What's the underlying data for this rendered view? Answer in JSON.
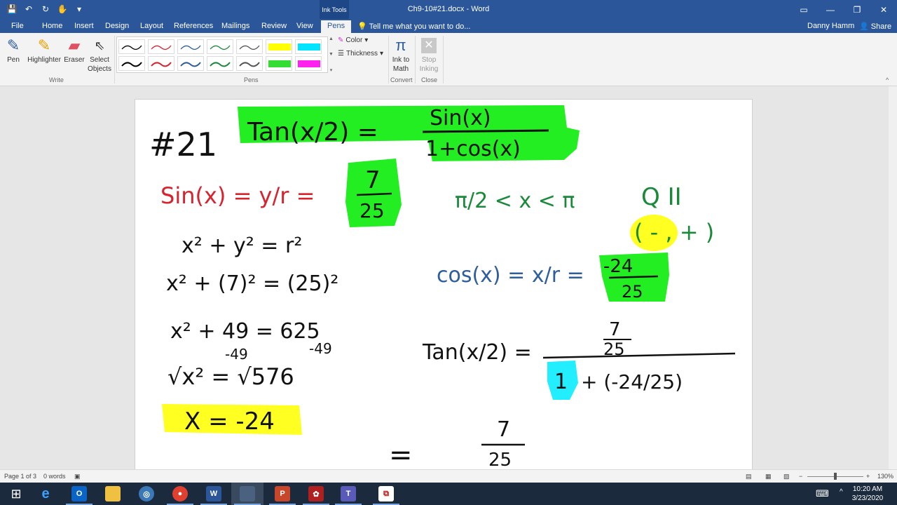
{
  "app": {
    "context_tab": "Ink Tools",
    "doc_title": "Ch9-10#21.docx - Word",
    "user": "Danny Hamm",
    "share_label": "Share",
    "tell_me": "Tell me what you want to do..."
  },
  "tabs": [
    {
      "label": "File"
    },
    {
      "label": "Home"
    },
    {
      "label": "Insert"
    },
    {
      "label": "Design"
    },
    {
      "label": "Layout"
    },
    {
      "label": "References"
    },
    {
      "label": "Mailings"
    },
    {
      "label": "Review"
    },
    {
      "label": "View"
    },
    {
      "label": "Pens",
      "active": true
    }
  ],
  "ribbon": {
    "write_group": "Write",
    "pens_group": "Pens",
    "convert_group": "Convert",
    "close_group": "Close",
    "pen": "Pen",
    "highlighter": "Highlighter",
    "eraser": "Eraser",
    "select_objects_1": "Select",
    "select_objects_2": "Objects",
    "color": "Color",
    "thickness": "Thickness",
    "ink_to_math_1": "Ink to",
    "ink_to_math_2": "Math",
    "stop_inking_1": "Stop",
    "stop_inking_2": "Inking",
    "pen_colors": [
      "#000000",
      "#d6232e",
      "#2e5e9e",
      "#1a8a3a",
      "#555555",
      "#ffff00",
      "#00e5ff",
      "#000000",
      "#d6232e",
      "#2e5e9e",
      "#1a8a3a",
      "#555555",
      "#33dd33",
      "#ff22ee"
    ]
  },
  "status": {
    "page": "Page 1 of 3",
    "words": "0 words",
    "zoom": "130%"
  },
  "taskbar": {
    "time": "10:20 AM",
    "date": "3/23/2020",
    "apps": [
      "start-icon",
      "ie-icon",
      "outlook-icon",
      "explorer-icon",
      "app-icon",
      "chrome-icon",
      "word-icon",
      "blank-app-icon",
      "powerpoint-icon",
      "paint-icon",
      "teams-icon",
      "acrobat-icon"
    ]
  },
  "ink": {
    "problem": "#21",
    "identity_lhs": "Tan(x/2) =",
    "identity_num": "Sin(x)",
    "identity_den": "1+cos(x)",
    "sin_line": "Sin(x) = y/r =",
    "sin_num": "7",
    "sin_den": "25",
    "pyth": "x² + y² = r²",
    "subst": "x² + (7)² = (25)²",
    "step1": "x² + 49 = 625",
    "step1_sub_left": "-49",
    "step1_sub_right": "-49",
    "step2": "√x² = √576",
    "result": "X = -24",
    "interval": "π/2 < x < π",
    "quadrant": "Q II",
    "signs": "( - , + )",
    "cos_line": "cos(x) = x/r =",
    "cos_num": "-24",
    "cos_den": "25",
    "tan_lhs": "Tan(x/2) =",
    "tan_num_top": "7",
    "tan_num_bot": "25",
    "tan_den_one": "1",
    "tan_den_rest": "+ (-24/25)",
    "eq_final": "=",
    "final_num": "7",
    "final_den": "25"
  }
}
